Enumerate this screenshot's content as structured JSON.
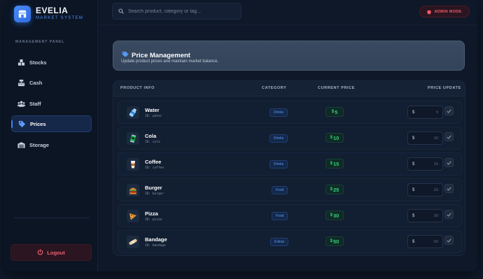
{
  "brand": {
    "name": "EVELIA",
    "subtitle": "MARKET SYSTEM"
  },
  "sidebar": {
    "section_label": "MANAGEMENT PANEL",
    "items": [
      {
        "label": "Stocks",
        "icon": "boxes-icon"
      },
      {
        "label": "Cash",
        "icon": "cash-register-icon"
      },
      {
        "label": "Staff",
        "icon": "users-icon"
      },
      {
        "label": "Prices",
        "icon": "tag-icon",
        "active": true
      },
      {
        "label": "Storage",
        "icon": "warehouse-icon"
      }
    ],
    "logout_label": "Logout"
  },
  "topbar": {
    "search_placeholder": "Search product, category or tag...",
    "admin_label": "ADMIN MODE"
  },
  "header": {
    "title": "Price Management",
    "description": "Update product prices and maintain market balance."
  },
  "table": {
    "columns": [
      "PRODUCT INFO",
      "CATEGORY",
      "CURRENT PRICE",
      "PRICE UPDATE"
    ],
    "currency": "$",
    "rows": [
      {
        "name": "Water",
        "id": "ID: water",
        "category": "Drinks",
        "price": "5",
        "input_placeholder": "5",
        "icon": "water-bottle-icon"
      },
      {
        "name": "Cola",
        "id": "ID: cola",
        "category": "Drinks",
        "price": "10",
        "input_placeholder": "10",
        "icon": "cola-can-icon"
      },
      {
        "name": "Coffee",
        "id": "ID: coffee",
        "category": "Drinks",
        "price": "15",
        "input_placeholder": "15",
        "icon": "coffee-cup-icon"
      },
      {
        "name": "Burger",
        "id": "ID: burger",
        "category": "Food",
        "price": "25",
        "input_placeholder": "25",
        "icon": "burger-icon"
      },
      {
        "name": "Pizza",
        "id": "ID: pizza",
        "category": "Food",
        "price": "30",
        "input_placeholder": "30",
        "icon": "pizza-icon"
      },
      {
        "name": "Bandage",
        "id": "ID: bandage",
        "category": "Extras",
        "price": "50",
        "input_placeholder": "50",
        "icon": "bandage-icon"
      }
    ]
  },
  "colors": {
    "accent": "#3b82f6",
    "danger": "#ef5a6b",
    "price_green": "#34d17a"
  }
}
